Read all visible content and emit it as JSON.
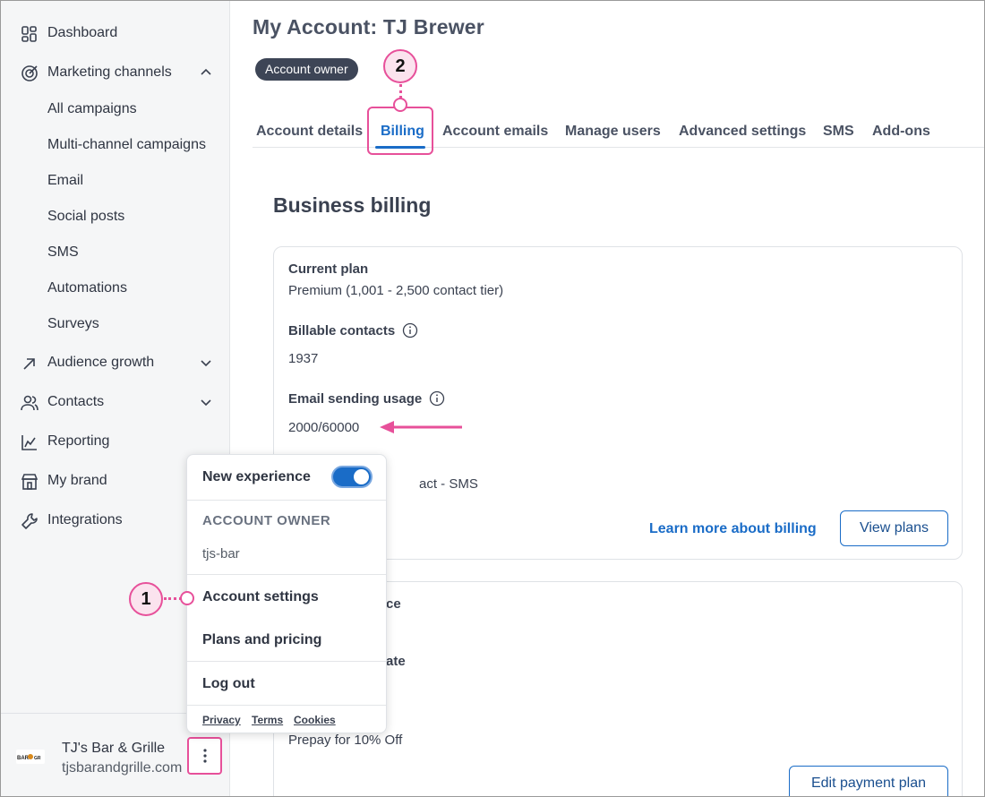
{
  "sidebar": {
    "items": [
      {
        "label": "Dashboard"
      },
      {
        "label": "Marketing channels"
      },
      {
        "label": "Audience growth"
      },
      {
        "label": "Contacts"
      },
      {
        "label": "Reporting"
      },
      {
        "label": "My brand"
      },
      {
        "label": "Integrations"
      }
    ],
    "sub_items": [
      "All campaigns",
      "Multi-channel campaigns",
      "Email",
      "Social posts",
      "SMS",
      "Automations",
      "Surveys"
    ],
    "account": {
      "name": "TJ's Bar & Grille",
      "domain": "tjsbarandgrille.com"
    }
  },
  "header": {
    "title": "My Account: TJ Brewer",
    "badge": "Account owner"
  },
  "tabs": [
    "Account details",
    "Billing",
    "Account emails",
    "Manage users",
    "Advanced settings",
    "SMS",
    "Add-ons"
  ],
  "active_tab": "Billing",
  "billing": {
    "section_title": "Business billing",
    "current_plan_label": "Current plan",
    "current_plan_value": "Premium (1,001 - 2,500 contact tier)",
    "billable_contacts_label": "Billable contacts",
    "billable_contacts_value": "1937",
    "email_usage_label": "Email sending usage",
    "email_usage_value": "2000/60000",
    "addon_partial": "act - SMS",
    "learn_more_link": "Learn more about billing",
    "view_plans_button": "View plans",
    "card2_partial_1": "ce",
    "card2_partial_2": "ate",
    "card2_prepay": "Prepay for 10% Off",
    "edit_payment_button": "Edit payment plan"
  },
  "menu": {
    "new_experience_label": "New experience",
    "account_owner_header": "ACCOUNT OWNER",
    "account_username": "tjs-bar",
    "account_settings": "Account settings",
    "plans_pricing": "Plans and pricing",
    "log_out": "Log out",
    "footer_links": [
      "Privacy",
      "Terms",
      "Cookies"
    ]
  },
  "callouts": [
    "1",
    "2"
  ],
  "colors": {
    "accent_blue": "#1a6cc7",
    "callout_pink": "#e7509a",
    "badge_dark": "#3d4556",
    "sidebar_bg": "#f5f6f7"
  }
}
